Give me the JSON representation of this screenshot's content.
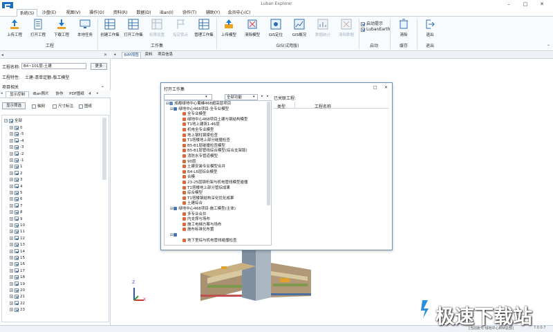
{
  "app": {
    "title": "Luban Explorer",
    "window_controls": [
      "–",
      "□",
      "✕"
    ],
    "version": "7.0.0.7",
    "status_text": "[当前账号:绿地中心BIM总部]"
  },
  "menu_tabs": [
    "系统(S)",
    "沙盘(E)",
    "视图(V)",
    "操作(O)",
    "资料(R)",
    "数据(D)",
    "iBan(I)",
    "协作(T)",
    "辅助(Y)",
    "会员中心(C)"
  ],
  "ribbon": {
    "groups": [
      {
        "label": "工程",
        "buttons": [
          "上传工程",
          "打开工程",
          "下载工程",
          "本地任务"
        ]
      },
      {
        "label": "工作集",
        "buttons": [
          "创建工作集",
          "打开工作集",
          "权限设置",
          "指定锁点",
          "管理工作集"
        ]
      },
      {
        "label": "GIS(试用版)",
        "buttons": [
          "上传模型",
          "清除模型",
          "GIS定位",
          "GIS概况",
          "数据统计",
          "清除数据"
        ]
      },
      {
        "label": "启动",
        "checkboxes": [
          "启动提示",
          "LubanEarth"
        ]
      },
      {
        "label": "缓存",
        "buttons": [
          "清除"
        ]
      },
      {
        "label": "退出",
        "buttons": [
          "退出"
        ]
      }
    ]
  },
  "left_panel": {
    "project_name_label": "工程名称:",
    "project_name_value": "B4~101层-土建",
    "more_button": "更多",
    "project_type_label": "工程特性:",
    "project_type_value": "土建-清单定额-版工模型",
    "project_related": "项目相关",
    "tabs": [
      "显示控制",
      "iBan照片",
      "协作",
      "PDF图纸",
      "4"
    ],
    "filter_button": "显示筛选",
    "filters": [
      "轴网",
      "尺寸标注",
      "图纸"
    ],
    "tree_root": "全部",
    "floors": [
      "0",
      "-5",
      "-4",
      "-3",
      "-2",
      "-1",
      "1",
      "2",
      "3",
      "4",
      "5",
      "6",
      "7",
      "8",
      "9",
      "10",
      "11",
      "12",
      "13",
      "14",
      "15",
      "16",
      "17",
      "18",
      "19",
      "20",
      "21",
      "22",
      "23"
    ]
  },
  "doc_tabs": [
    "BIM视图",
    "资料",
    "项目信息"
  ],
  "dialog": {
    "title": "打开工作集",
    "filter_select": "全部功能",
    "right_label": "已关联工程:",
    "columns": [
      "类型",
      "工程名称"
    ],
    "tree": [
      {
        "level": 0,
        "text": "成都绿地中心蜀峰468超高层项目"
      },
      {
        "level": 1,
        "text": "绿地中心468项目-全专业模型"
      },
      {
        "level": 2,
        "text": "全专业模型"
      },
      {
        "level": 2,
        "text": "绿地中心468项目土建与钢结构模型"
      },
      {
        "level": 2,
        "text": "T1地上建筑1-46层"
      },
      {
        "level": 2,
        "text": "机电全专业模型"
      },
      {
        "level": 2,
        "text": "地上钢柱钢梁检查"
      },
      {
        "level": 2,
        "text": "T1塔楼地上部分碰撞检查"
      },
      {
        "level": 2,
        "text": "B5-B1层碰撞检查模型"
      },
      {
        "level": 2,
        "text": "B5-B1层管线综合模型(综合支架版)"
      },
      {
        "level": 2,
        "text": "消防水专管道模型"
      },
      {
        "level": 2,
        "text": "90层"
      },
      {
        "level": 2,
        "text": "土建安装专业模型合并"
      },
      {
        "level": 2,
        "text": "B4-L6层综合模型"
      },
      {
        "level": 2,
        "text": "合模"
      },
      {
        "level": 2,
        "text": "23-25层钢桁架与机电管线模型碰撞"
      },
      {
        "level": 2,
        "text": "T1塔楼地上部分管综成果"
      },
      {
        "level": 2,
        "text": "综合模型"
      },
      {
        "level": 2,
        "text": "T1塔楼钢结构深化优化成果"
      },
      {
        "level": 2,
        "text": "土建综合"
      },
      {
        "level": 1,
        "text": "绿地中心468项目-施工模型(主体)"
      },
      {
        "level": 2,
        "text": "多专业合并"
      },
      {
        "level": 2,
        "text": "内支撑与场布"
      },
      {
        "level": 2,
        "text": "施工电梯方案与场布"
      },
      {
        "level": 2,
        "text": "施布标准化布置"
      },
      {
        "level": 1,
        "text": ""
      },
      {
        "level": 2,
        "text": "地下室综与机电管线碰撞检查"
      }
    ]
  },
  "watermark": "极速下载站",
  "axis_labels": [
    "Z",
    "X"
  ]
}
